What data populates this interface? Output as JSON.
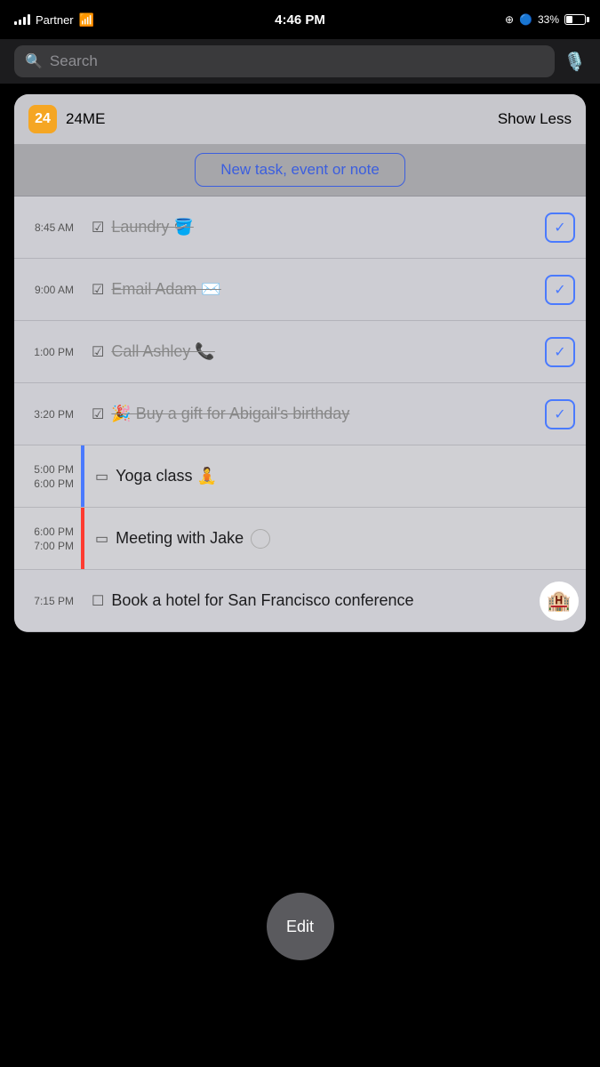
{
  "statusBar": {
    "carrier": "Partner",
    "time": "4:46 PM",
    "battery_percent": "33%"
  },
  "searchBar": {
    "placeholder": "Search"
  },
  "widget": {
    "app_icon_label": "24",
    "app_name": "24ME",
    "show_less": "Show Less",
    "new_task_btn": "New task, event or note"
  },
  "tasks": [
    {
      "id": "laundry",
      "time": "8:45 AM",
      "time2": null,
      "type": "task",
      "checked": true,
      "text": "Laundry 🪣",
      "strikethrough": true,
      "has_action": true
    },
    {
      "id": "email-adam",
      "time": "9:00 AM",
      "time2": null,
      "type": "task",
      "checked": true,
      "text": "Email Adam ✉️",
      "strikethrough": true,
      "has_action": true
    },
    {
      "id": "call-ashley",
      "time": "1:00 PM",
      "time2": null,
      "type": "task",
      "checked": true,
      "text": "Call Ashley 📞",
      "strikethrough": true,
      "has_action": true
    },
    {
      "id": "birthday-gift",
      "time": "3:20 PM",
      "time2": null,
      "type": "task",
      "checked": true,
      "text": "🎉 Buy a gift for Abigail's birthday",
      "strikethrough": true,
      "has_action": true
    },
    {
      "id": "yoga-class",
      "time": "5:00 PM",
      "time2": "6:00 PM",
      "type": "event",
      "indicator": "blue",
      "text": "Yoga class 🧘",
      "strikethrough": false,
      "has_action": false
    },
    {
      "id": "meeting-jake",
      "time": "6:00 PM",
      "time2": "7:00 PM",
      "type": "event",
      "indicator": "red",
      "text": "Meeting with Jake",
      "strikethrough": false,
      "has_action": false,
      "has_circle": true
    },
    {
      "id": "hotel-sf",
      "time": "7:15 PM",
      "time2": null,
      "type": "task",
      "checked": false,
      "text": "Book a hotel for San Francisco conference",
      "strikethrough": false,
      "has_action": false,
      "has_hotel": true
    }
  ],
  "editButton": {
    "label": "Edit"
  }
}
